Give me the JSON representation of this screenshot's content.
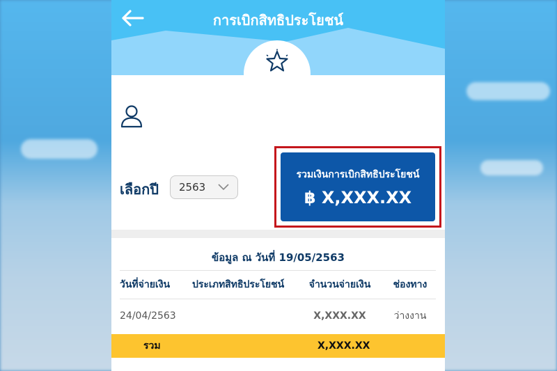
{
  "header": {
    "title": "การเบิกสิทธิประโยชน์"
  },
  "filter": {
    "year_label": "เลือกปี",
    "year_value": "2563"
  },
  "summary": {
    "title": "รวมเงินการเบิกสิทธิประโยชน์",
    "amount": "฿ X,XXX.XX"
  },
  "table": {
    "date_note": "ข้อมูล ณ วันที่ 19/05/2563",
    "columns": [
      "วันที่จ่ายเงิน",
      "ประเภทสิทธิประโยชน์",
      "จำนวนจ่ายเงิน",
      "ช่องทาง"
    ],
    "rows": [
      {
        "date": "24/04/2563",
        "type": "",
        "amount": "X,XXX.XX",
        "channel": "ว่างงาน"
      }
    ],
    "total_label": "รวม",
    "total_amount": "X,XXX.XX"
  },
  "icons": {
    "back": "arrow-left-icon",
    "star": "star-icon",
    "user": "user-icon",
    "chevron": "chevron-down-icon"
  },
  "colors": {
    "header_blue": "#48c1f5",
    "summary_blue": "#0d57a8",
    "highlight_red": "#c4161c",
    "total_yellow": "#fdc42f",
    "text_navy": "#0f3a66"
  }
}
